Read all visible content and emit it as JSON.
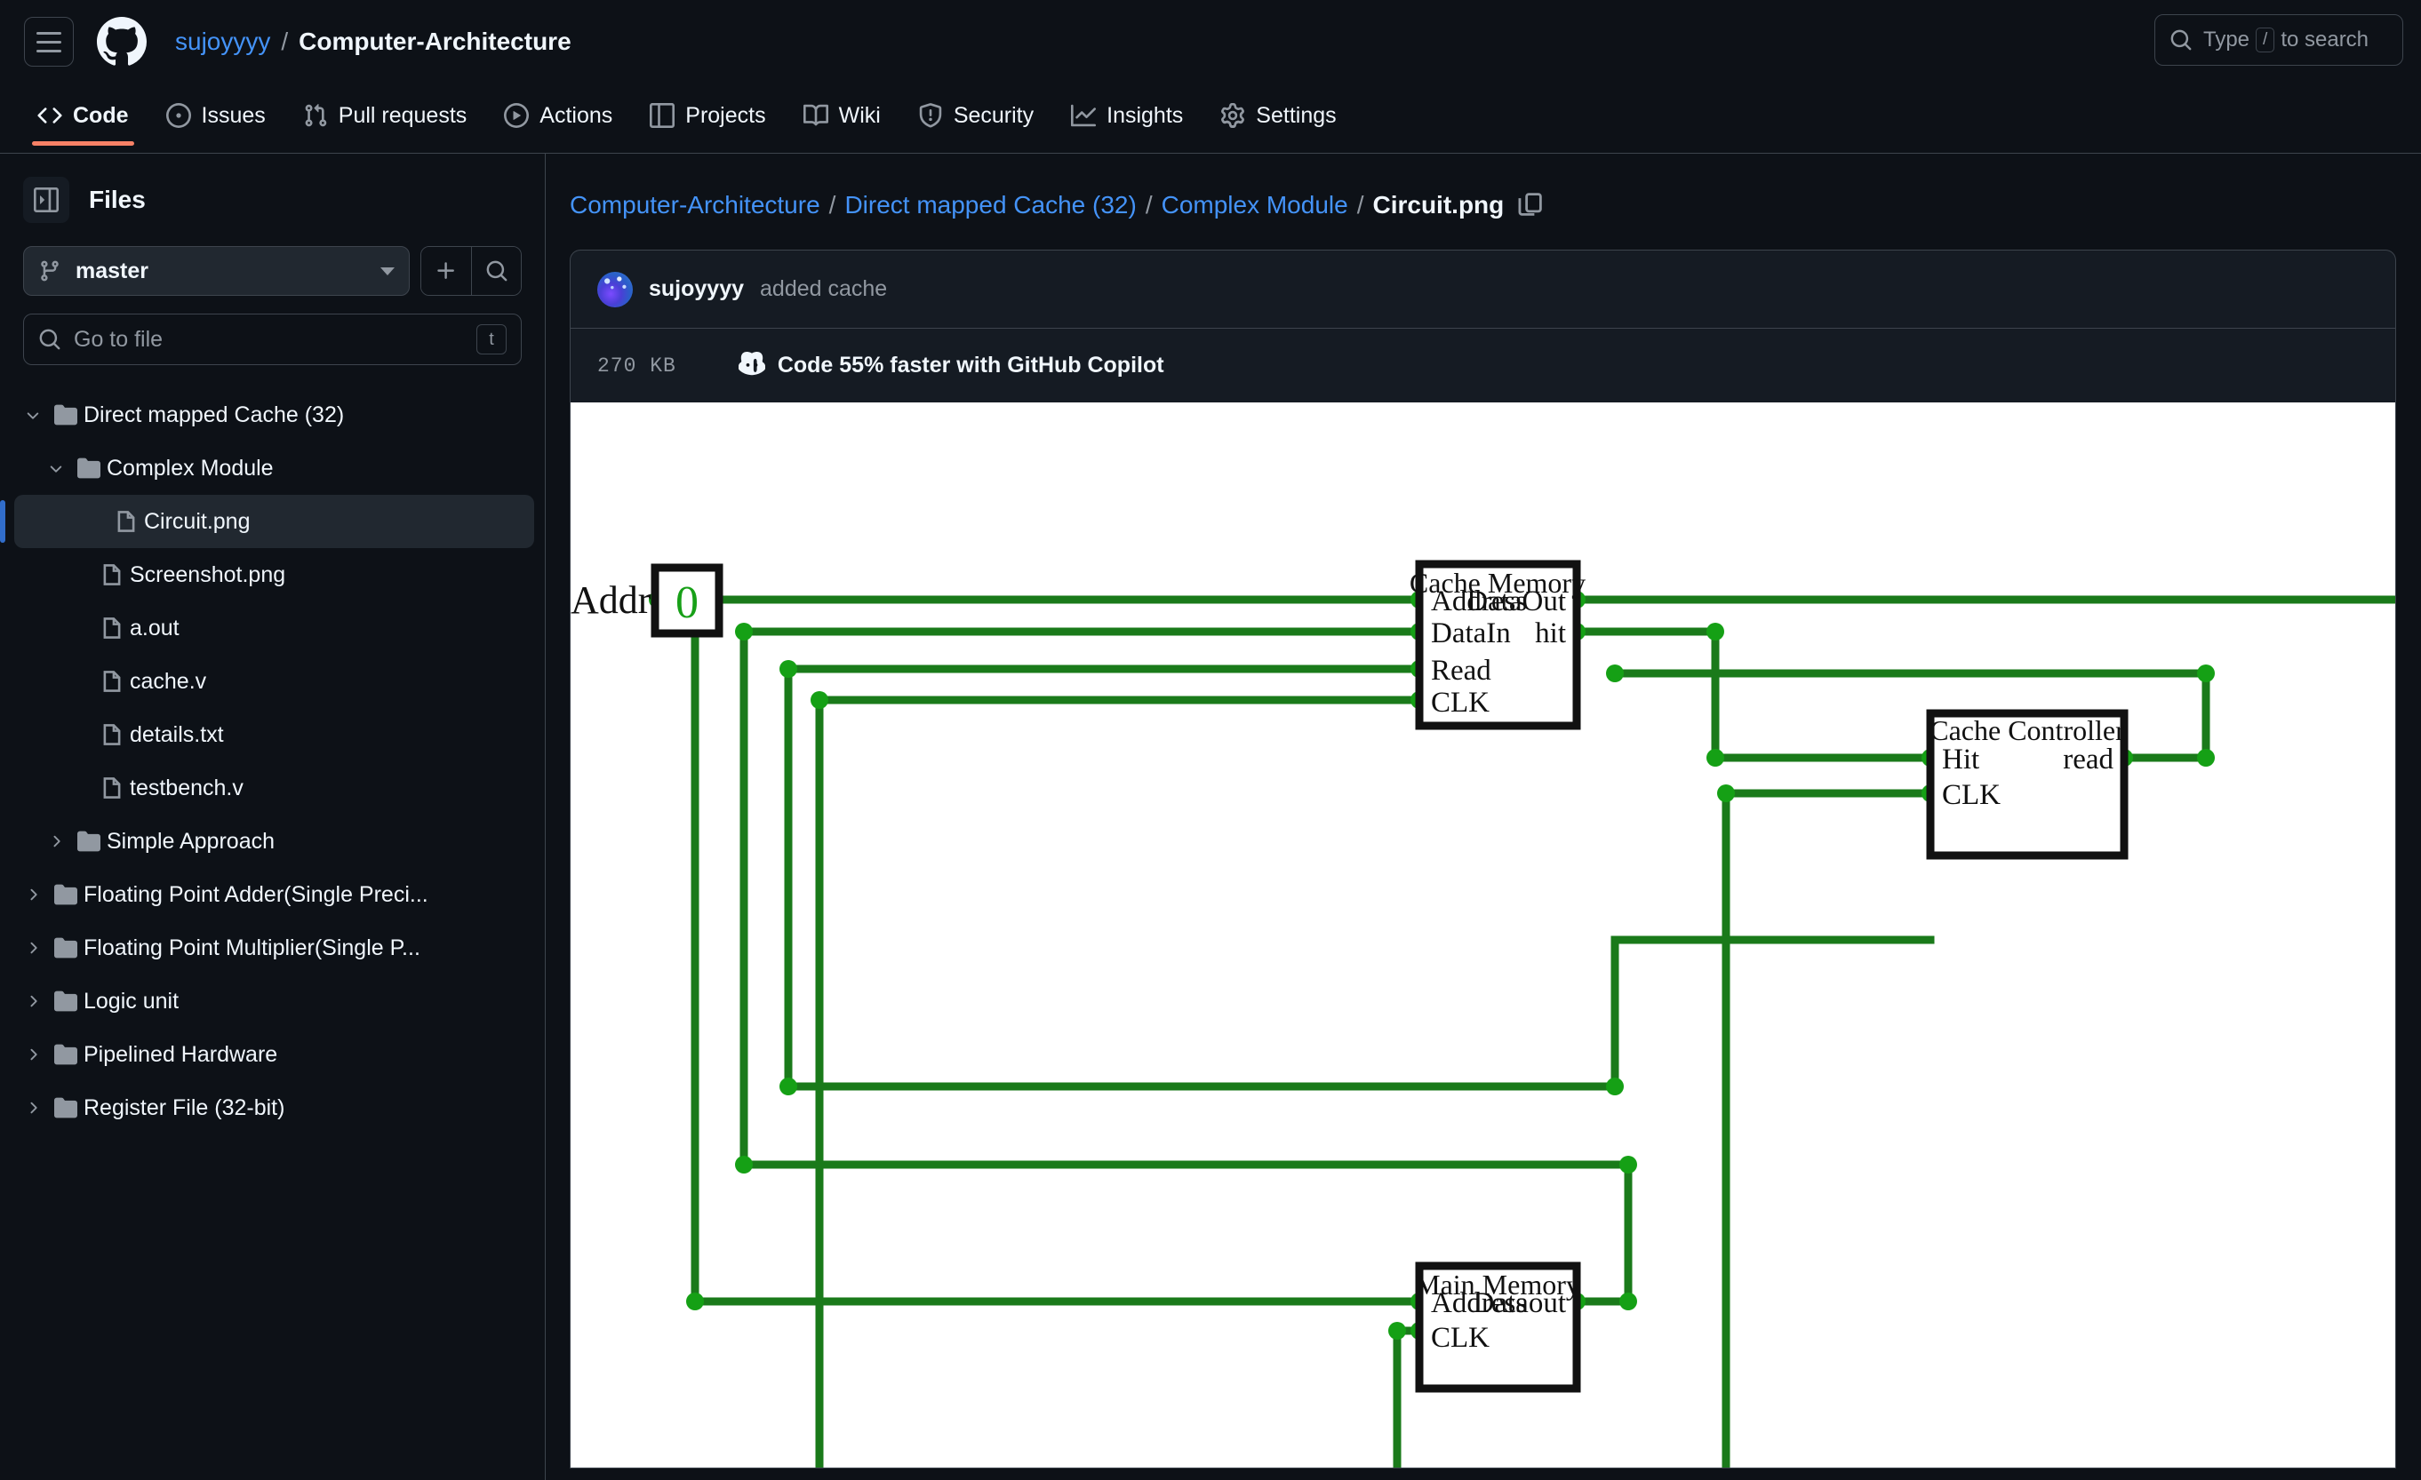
{
  "header": {
    "menu_icon": "hamburger-icon",
    "logo_icon": "github-logo-icon",
    "owner": "sujoyyyy",
    "separator": "/",
    "repo": "Computer-Architecture",
    "search": {
      "placeholder_prefix": "Type",
      "slash_key": "/",
      "placeholder_suffix": "to search",
      "icon": "search-icon"
    }
  },
  "nav": {
    "tabs": [
      {
        "label": "Code",
        "icon": "code-icon",
        "active": true
      },
      {
        "label": "Issues",
        "icon": "issue-opened-icon",
        "active": false
      },
      {
        "label": "Pull requests",
        "icon": "git-pull-request-icon",
        "active": false
      },
      {
        "label": "Actions",
        "icon": "play-icon",
        "active": false
      },
      {
        "label": "Projects",
        "icon": "table-icon",
        "active": false
      },
      {
        "label": "Wiki",
        "icon": "book-icon",
        "active": false
      },
      {
        "label": "Security",
        "icon": "shield-icon",
        "active": false
      },
      {
        "label": "Insights",
        "icon": "graph-icon",
        "active": false
      },
      {
        "label": "Settings",
        "icon": "gear-icon",
        "active": false
      }
    ],
    "active_underline_color": "#f78166"
  },
  "sidebar": {
    "title": "Files",
    "toggle_icon": "sidebar-collapse-icon",
    "branch": {
      "name": "master",
      "icon": "git-branch-icon"
    },
    "add_icon": "plus-icon",
    "search_icon": "search-icon",
    "go_to_file": {
      "placeholder": "Go to file",
      "icon": "search-icon",
      "shortcut": "t"
    },
    "tree": [
      {
        "label": "Direct mapped Cache (32)",
        "type": "folder",
        "depth": 0,
        "expanded": true,
        "selected": false
      },
      {
        "label": "Complex Module",
        "type": "folder",
        "depth": 1,
        "expanded": true,
        "selected": false
      },
      {
        "label": "Circuit.png",
        "type": "file",
        "depth": 2,
        "expanded": false,
        "selected": true
      },
      {
        "label": "Screenshot.png",
        "type": "file",
        "depth": 2,
        "expanded": false,
        "selected": false
      },
      {
        "label": "a.out",
        "type": "file",
        "depth": 2,
        "expanded": false,
        "selected": false
      },
      {
        "label": "cache.v",
        "type": "file",
        "depth": 2,
        "expanded": false,
        "selected": false
      },
      {
        "label": "details.txt",
        "type": "file",
        "depth": 2,
        "expanded": false,
        "selected": false
      },
      {
        "label": "testbench.v",
        "type": "file",
        "depth": 2,
        "expanded": false,
        "selected": false
      },
      {
        "label": "Simple Approach",
        "type": "folder",
        "depth": 1,
        "expanded": false,
        "selected": false
      },
      {
        "label": "Floating Point Adder(Single Preci...",
        "type": "folder",
        "depth": 0,
        "expanded": false,
        "selected": false
      },
      {
        "label": "Floating Point Multiplier(Single P...",
        "type": "folder",
        "depth": 0,
        "expanded": false,
        "selected": false
      },
      {
        "label": "Logic unit",
        "type": "folder",
        "depth": 0,
        "expanded": false,
        "selected": false
      },
      {
        "label": "Pipelined Hardware",
        "type": "folder",
        "depth": 0,
        "expanded": false,
        "selected": false
      },
      {
        "label": "Register File (32-bit)",
        "type": "folder",
        "depth": 0,
        "expanded": false,
        "selected": false
      }
    ]
  },
  "main": {
    "breadcrumb": {
      "parts": [
        "Computer-Architecture",
        "Direct mapped Cache (32)",
        "Complex Module"
      ],
      "separator": "/",
      "current": "Circuit.png",
      "copy_icon": "copy-path-icon"
    },
    "commit": {
      "avatar": "user-avatar",
      "author": "sujoyyyy",
      "message": "added cache"
    },
    "file_meta": {
      "size": "270 KB",
      "copilot_icon": "copilot-icon",
      "copilot_text": "Code 55% faster with GitHub Copilot"
    },
    "image": {
      "alt": "Circuit.png",
      "input_label": "Address",
      "input_value": "0",
      "wire_color": "#1a7a1a",
      "node_color": "#15a015",
      "blocks": [
        {
          "name": "Cache Memory",
          "inputs": [
            "Address",
            "DataIn",
            "Read",
            "CLK"
          ],
          "outputs": [
            "DataOut",
            "hit"
          ]
        },
        {
          "name": "Cache Controller",
          "inputs": [
            "Hit",
            "CLK"
          ],
          "outputs": [
            "read"
          ]
        },
        {
          "name": "Main Memory",
          "inputs": [
            "Address",
            "CLK"
          ],
          "outputs": [
            "Dataout"
          ]
        }
      ]
    }
  }
}
